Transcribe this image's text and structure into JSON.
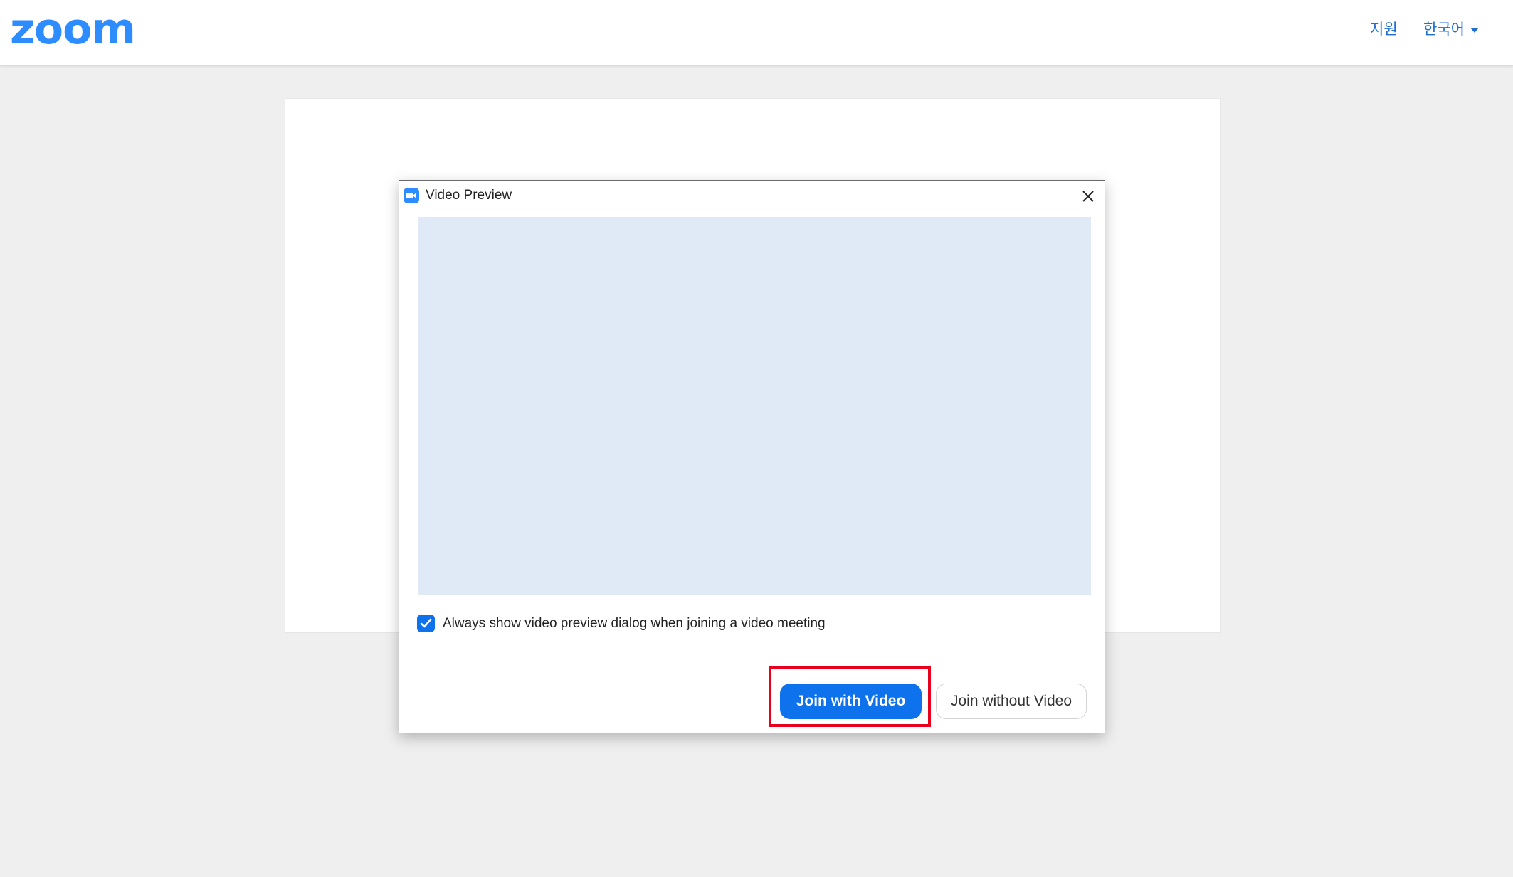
{
  "header": {
    "logo_text": "zoom",
    "support_label": "지원",
    "language_label": "한국어"
  },
  "dialog": {
    "title": "Video Preview",
    "app_icon": "zoom-camera-icon",
    "close_icon": "close-icon",
    "always_show_checked": true,
    "always_show_label": "Always show video preview dialog when joining a video meeting",
    "join_with_video_label": "Join with Video",
    "join_without_video_label": "Join without Video"
  },
  "colors": {
    "brand_blue": "#2d8cff",
    "button_blue": "#0e72ed",
    "preview_bg": "#dfeaf6",
    "highlight_red": "#e8001c",
    "page_bg": "#efefef"
  }
}
